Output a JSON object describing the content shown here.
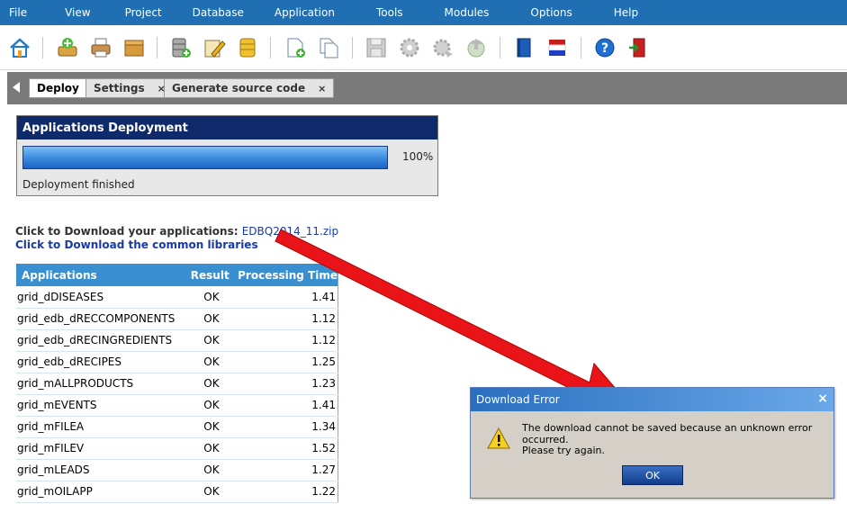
{
  "menu": [
    "File",
    "View",
    "Project",
    "Database",
    "Application",
    "Tools",
    "Modules",
    "Options",
    "Help"
  ],
  "tabs": [
    {
      "label": "Deploy",
      "closable": false
    },
    {
      "label": "Settings",
      "closable": true
    },
    {
      "label": "Generate source code",
      "closable": true
    }
  ],
  "tab_close_glyph": "×",
  "deploy": {
    "title": "Applications Deployment",
    "progress_percent": 100,
    "progress_label": "100%",
    "status": "Deployment finished"
  },
  "download": {
    "prefix": "Click to Download your applications:",
    "file_link": "EDBQ2014_11.zip",
    "libraries_link": "Click to Download the common libraries"
  },
  "table": {
    "headers": [
      "Applications",
      "Result",
      "Processing Time"
    ],
    "rows": [
      [
        "grid_dDISEASES",
        "OK",
        "1.41"
      ],
      [
        "grid_edb_dRECCOMPONENTS",
        "OK",
        "1.12"
      ],
      [
        "grid_edb_dRECINGREDIENTS",
        "OK",
        "1.12"
      ],
      [
        "grid_edb_dRECIPES",
        "OK",
        "1.25"
      ],
      [
        "grid_mALLPRODUCTS",
        "OK",
        "1.23"
      ],
      [
        "grid_mEVENTS",
        "OK",
        "1.41"
      ],
      [
        "grid_mFILEA",
        "OK",
        "1.34"
      ],
      [
        "grid_mFILEV",
        "OK",
        "1.52"
      ],
      [
        "grid_mLEADS",
        "OK",
        "1.27"
      ],
      [
        "grid_mOILAPP",
        "OK",
        "1.22"
      ]
    ]
  },
  "dialog": {
    "title": "Download Error",
    "message": "The download cannot be saved because an unknown error occurred.",
    "message2": "Please try again.",
    "ok": "OK",
    "close_glyph": "×"
  },
  "colors": {
    "menubar": "#1f6fb2",
    "deploy_header": "#0e2a6a",
    "table_header": "#3a8fd0",
    "link": "#1a3aa8",
    "arrow": "#e8141a"
  },
  "icons": [
    "home-icon",
    "add-connection-icon",
    "print-icon",
    "archive-icon",
    "database-add-icon",
    "database-edit-icon",
    "database-icon",
    "new-document-icon",
    "copy-document-icon",
    "save-icon",
    "gear-icon",
    "gear-run-icon",
    "deploy-globe-icon",
    "book-icon",
    "flags-icon",
    "help-icon",
    "exit-icon"
  ]
}
